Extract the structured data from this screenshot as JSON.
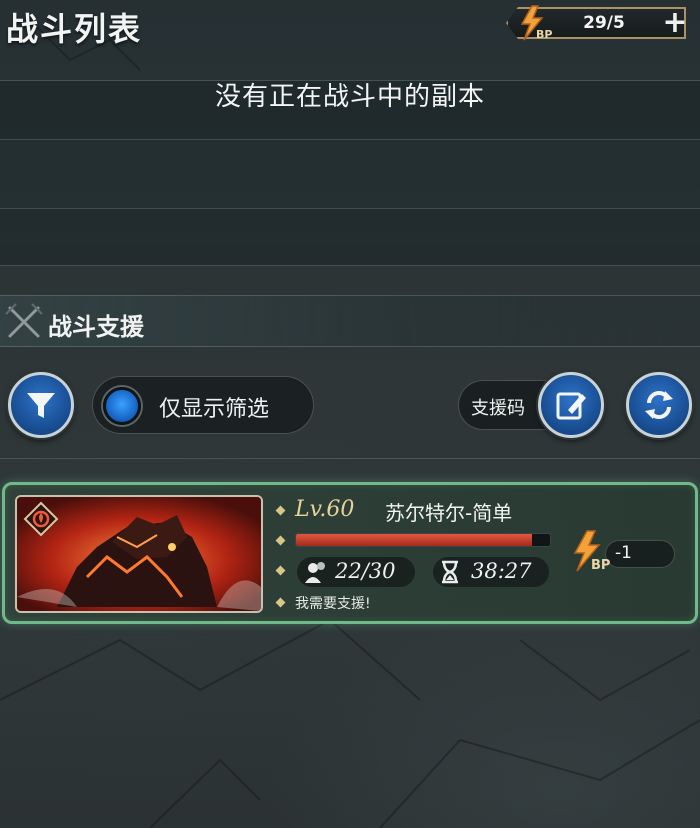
{
  "header": {
    "title": "战斗列表",
    "bp_counter": "29/5",
    "bp_icon_label": "BP",
    "plus_label": "+"
  },
  "battles": {
    "empty_message": "没有正在战斗中的副本"
  },
  "support": {
    "section_title": "战斗支援",
    "filter_toggle_label": "仅显示筛选",
    "support_code_label": "支援码"
  },
  "quest_card": {
    "level": "Lv.60",
    "boss_name": "苏尔特尔-简单",
    "hp_fraction": 0.93,
    "participants": "22/30",
    "time_left": "38:27",
    "message": "我需要支援!",
    "bp_cost_label": "BP",
    "bp_cost": "-1"
  },
  "colors": {
    "accent_blue": "#2d73c9",
    "card_border": "#6fb98b",
    "hp_red": "#e0583f",
    "gold": "#a89266"
  }
}
